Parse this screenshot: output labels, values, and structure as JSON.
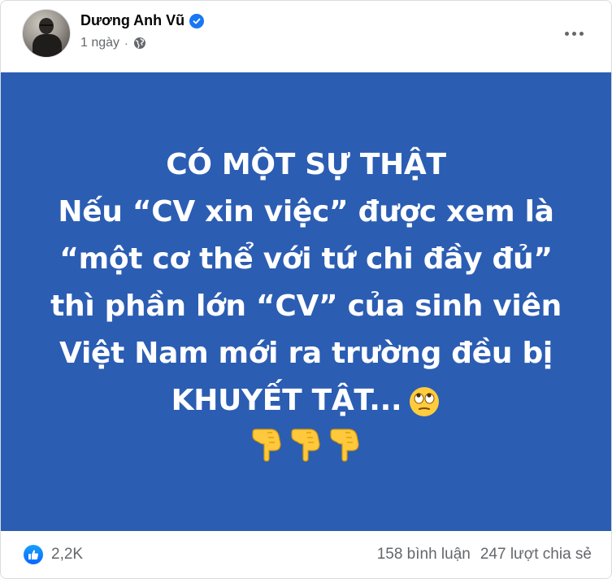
{
  "post": {
    "author": "Dương Anh Vũ",
    "verified_icon": "verified-badge-icon",
    "timestamp": "1 ngày",
    "separator": "·",
    "privacy_icon": "globe-icon",
    "more_icon": "more-options-icon"
  },
  "image": {
    "background_color": "#2B5DB3",
    "text_color": "#FFFFFF",
    "lines": [
      "CÓ MỘT SỰ THẬT",
      "Nếu “CV xin việc” được xem là",
      "“một cơ thể với tứ chi đầy đủ”",
      "thì phần lớn “CV” của sinh viên",
      "Việt Nam mới ra trường đều bị",
      "KHUYẾT TẬT..."
    ],
    "eye_roll_emoji": "face-with-rolling-eyes-icon",
    "pointing_emojis": [
      "backhand-index-pointing-down-icon",
      "backhand-index-pointing-down-icon",
      "backhand-index-pointing-down-icon"
    ]
  },
  "footer": {
    "like_icon": "like-reaction-icon",
    "reaction_count": "2,2K",
    "comments": "158 bình luận",
    "shares": "247 lượt chia sẻ"
  }
}
